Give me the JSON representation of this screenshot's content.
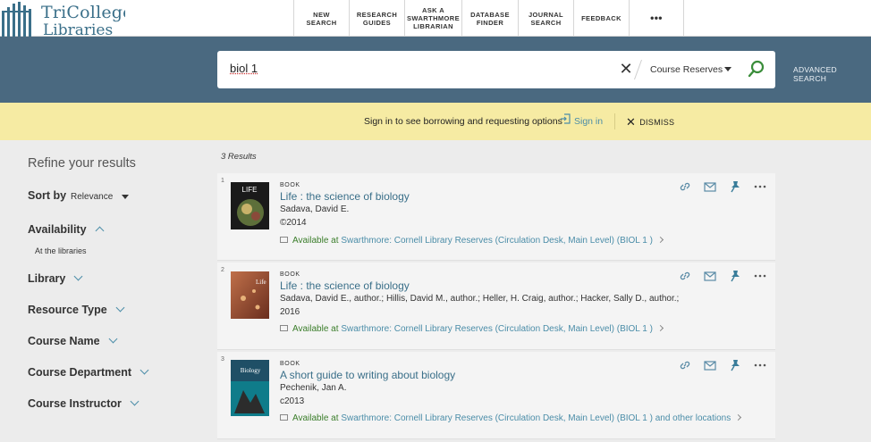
{
  "header": {
    "logo_line1": "TriCollege",
    "logo_line2": "Libraries",
    "nav": [
      {
        "label": "NEW SEARCH",
        "width": 62
      },
      {
        "label": "RESEARCH GUIDES",
        "width": 62
      },
      {
        "label": "ASK A SWARTHMORE LIBRARIAN",
        "width": 64
      },
      {
        "label": "DATABASE FINDER",
        "width": 63
      },
      {
        "label": "JOURNAL SEARCH",
        "width": 62
      },
      {
        "label": "FEEDBACK",
        "width": 62
      },
      {
        "label": "•••",
        "width": 62
      }
    ]
  },
  "search": {
    "query": "biol 1",
    "scope": "Course Reserves",
    "advanced_label": "ADVANCED SEARCH"
  },
  "banner": {
    "message": "Sign in to see borrowing and requesting options",
    "signin_label": "Sign in",
    "dismiss_label": "DISMISS"
  },
  "sidebar": {
    "title": "Refine your results",
    "sort_label": "Sort by",
    "sort_value": "Relevance",
    "facets": [
      {
        "label": "Availability",
        "expanded": true
      },
      {
        "label": "Library",
        "expanded": false
      },
      {
        "label": "Resource Type",
        "expanded": false
      },
      {
        "label": "Course Name",
        "expanded": false
      },
      {
        "label": "Course Department",
        "expanded": false
      },
      {
        "label": "Course Instructor",
        "expanded": false
      }
    ],
    "availability_option": "At the libraries"
  },
  "results": {
    "count_label": "3 Results",
    "items": [
      {
        "num": "1",
        "type": "BOOK",
        "title": "Life : the science of biology",
        "authors": "Sadava, David E.",
        "date": "©2014",
        "avail_label": "Available at",
        "location": "Swarthmore: Cornell Library  Reserves (Circulation Desk, Main Level) (BIOL 1 )"
      },
      {
        "num": "2",
        "type": "BOOK",
        "title": "Life : the science of biology",
        "authors": "Sadava, David E., author.; Hillis, David M., author.; Heller, H. Craig, author.; Hacker, Sally D., author.;",
        "date": "2016",
        "avail_label": "Available at",
        "location": "Swarthmore: Cornell Library  Reserves (Circulation Desk, Main Level) (BIOL 1 )"
      },
      {
        "num": "3",
        "type": "BOOK",
        "title": "A short guide to writing about biology",
        "authors": "Pechenik, Jan A.",
        "date": "c2013",
        "avail_label": "Available at",
        "location": "Swarthmore: Cornell Library  Reserves (Circulation Desk, Main Level) (BIOL 1 ) and other locations"
      }
    ]
  },
  "colors": {
    "accent": "#4b8da8",
    "header_band": "#4a6980",
    "banner": "#f6eba3",
    "available": "#3a7d2a"
  }
}
